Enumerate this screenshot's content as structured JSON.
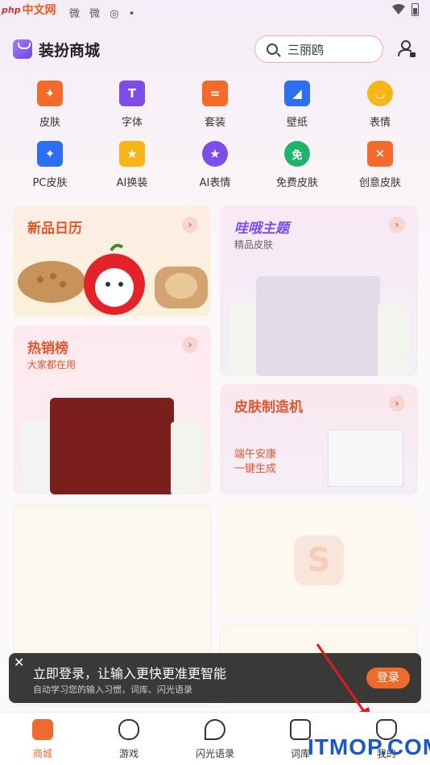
{
  "watermark": {
    "logo": "php",
    "text": "中文网",
    "bottom": "ITMOP.COM"
  },
  "status": {
    "left_icons": "微 微 ◎ •"
  },
  "header": {
    "title": "装扮商城",
    "search_placeholder": "三丽鸥"
  },
  "categories": [
    {
      "label": "皮肤",
      "icon": "tshirt-icon",
      "color": "#f36b2b"
    },
    {
      "label": "字体",
      "icon": "font-icon",
      "color": "#7c4de8"
    },
    {
      "label": "套装",
      "icon": "suit-icon",
      "color": "#f36b2b"
    },
    {
      "label": "壁纸",
      "icon": "wallpaper-icon",
      "color": "#2d6ff2"
    },
    {
      "label": "表情",
      "icon": "emoji-icon",
      "color": "#f7b618"
    },
    {
      "label": "PC皮肤",
      "icon": "monitor-icon",
      "color": "#2d6ff2"
    },
    {
      "label": "AI换装",
      "icon": "ai-outfit-icon",
      "color": "#f7b618"
    },
    {
      "label": "AI表情",
      "icon": "ai-emoji-icon",
      "color": "#7c4de8"
    },
    {
      "label": "免费皮肤",
      "icon": "free-skin-icon",
      "color": "#1fb46a"
    },
    {
      "label": "创意皮肤",
      "icon": "creative-skin-icon",
      "color": "#f36b2b"
    }
  ],
  "cards": {
    "new_calendar": {
      "title": "新品日历"
    },
    "wahaha": {
      "title": "哇哦主题",
      "sub": "精品皮肤"
    },
    "hot": {
      "title": "热销榜",
      "sub": "大家都在用"
    },
    "maker": {
      "title": "皮肤制造机",
      "line1": "端午安康",
      "line2": "一键生成"
    }
  },
  "banner": {
    "title": "立即登录，让输入更快更准更智能",
    "subtitle": "自动学习您的输入习惯，词库、闪光语录",
    "button": "登录"
  },
  "tabs": [
    {
      "label": "商城",
      "active": true
    },
    {
      "label": "游戏",
      "active": false
    },
    {
      "label": "闪光语录",
      "active": false
    },
    {
      "label": "词库",
      "active": false
    },
    {
      "label": "我的",
      "active": false
    }
  ]
}
